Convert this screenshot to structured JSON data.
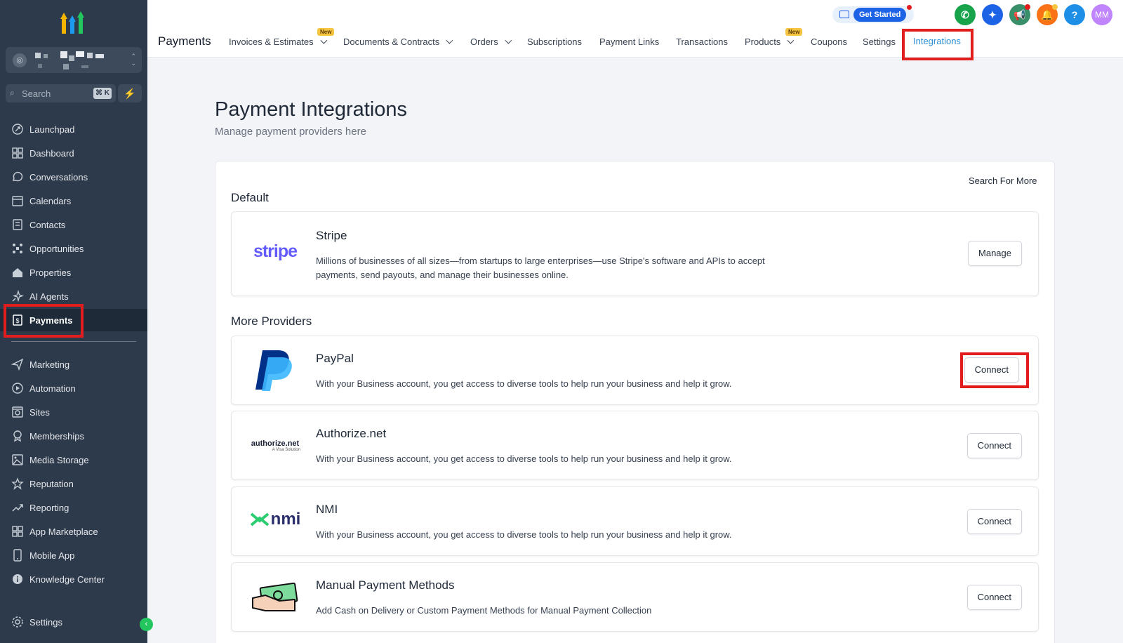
{
  "sidebar": {
    "search_placeholder": "Search",
    "search_shortcut": "⌘ K",
    "items": [
      {
        "label": "Launchpad",
        "icon": "rocket-icon"
      },
      {
        "label": "Dashboard",
        "icon": "grid-icon"
      },
      {
        "label": "Conversations",
        "icon": "chat-icon"
      },
      {
        "label": "Calendars",
        "icon": "calendar-icon"
      },
      {
        "label": "Contacts",
        "icon": "contacts-icon"
      },
      {
        "label": "Opportunities",
        "icon": "pipeline-icon"
      },
      {
        "label": "Properties",
        "icon": "house-icon"
      },
      {
        "label": "AI Agents",
        "icon": "sparkle-icon"
      },
      {
        "label": "Payments",
        "icon": "receipt-icon"
      },
      {
        "label": "Marketing",
        "icon": "send-icon"
      },
      {
        "label": "Automation",
        "icon": "automation-icon"
      },
      {
        "label": "Sites",
        "icon": "sites-icon"
      },
      {
        "label": "Memberships",
        "icon": "badge-icon"
      },
      {
        "label": "Media Storage",
        "icon": "image-icon"
      },
      {
        "label": "Reputation",
        "icon": "star-icon"
      },
      {
        "label": "Reporting",
        "icon": "trend-icon"
      },
      {
        "label": "App Marketplace",
        "icon": "apps-icon"
      },
      {
        "label": "Mobile App",
        "icon": "phone-icon"
      },
      {
        "label": "Knowledge Center",
        "icon": "info-icon"
      }
    ],
    "settings_label": "Settings"
  },
  "header": {
    "title": "Payments",
    "tabs": [
      {
        "label": "Invoices & Estimates",
        "new": true,
        "dropdown": true
      },
      {
        "label": "Documents & Contracts",
        "new": false,
        "dropdown": true
      },
      {
        "label": "Orders",
        "new": false,
        "dropdown": true
      },
      {
        "label": "Subscriptions",
        "new": false,
        "dropdown": false
      },
      {
        "label": "Payment Links",
        "new": false,
        "dropdown": false
      },
      {
        "label": "Transactions",
        "new": false,
        "dropdown": false
      },
      {
        "label": "Products",
        "new": true,
        "dropdown": true
      },
      {
        "label": "Coupons",
        "new": false,
        "dropdown": false
      },
      {
        "label": "Settings",
        "new": false,
        "dropdown": false
      },
      {
        "label": "Integrations",
        "new": false,
        "dropdown": false
      }
    ],
    "new_badge": "New",
    "get_started": "Get Started",
    "avatar_initials": "MM",
    "help_glyph": "?"
  },
  "main": {
    "heading": "Payment Integrations",
    "subheading": "Manage payment providers here",
    "search_more": "Search For More",
    "default_section": "Default",
    "more_section": "More Providers",
    "providers": [
      {
        "name": "Stripe",
        "logo_text": "stripe",
        "description": "Millions of businesses of all sizes—from startups to large enterprises—use Stripe's software and APIs to accept payments, send payouts, and manage their businesses online.",
        "button": "Manage"
      },
      {
        "name": "PayPal",
        "logo_text": "",
        "description": "With your Business account, you get access to diverse tools to help run your business and help it grow.",
        "button": "Connect"
      },
      {
        "name": "Authorize.net",
        "logo_text": "authorize.net",
        "logo_sub": "A Visa Solution",
        "description": "With your Business account, you get access to diverse tools to help run your business and help it grow.",
        "button": "Connect"
      },
      {
        "name": "NMI",
        "logo_text": "nmi",
        "description": "With your Business account, you get access to diverse tools to help run your business and help it grow.",
        "button": "Connect"
      },
      {
        "name": "Manual Payment Methods",
        "logo_text": "",
        "description": "Add Cash on Delivery or Custom Payment Methods for Manual Payment Collection",
        "button": "Connect"
      }
    ]
  },
  "colors": {
    "sidebar_bg": "#2d3a4b",
    "accent_blue": "#2b8fd6",
    "highlight_red": "#e11d1d",
    "stripe_purple": "#635bff"
  }
}
